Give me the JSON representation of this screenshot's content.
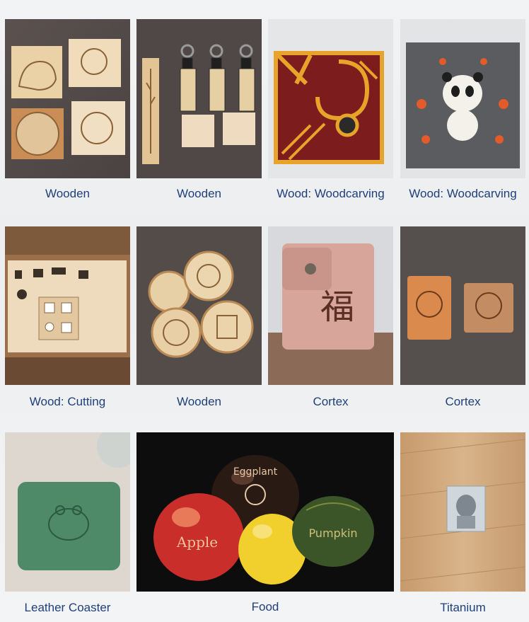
{
  "gallery": {
    "items": [
      {
        "label": "Wooden"
      },
      {
        "label": "Wooden"
      },
      {
        "label": "Wood: Woodcarving"
      },
      {
        "label": "Wood: Woodcarving"
      },
      {
        "label": "Wood: Cutting"
      },
      {
        "label": "Wooden"
      },
      {
        "label": "Cortex"
      },
      {
        "label": "Cortex"
      },
      {
        "label": "Leather Coaster"
      },
      {
        "label": "Food"
      },
      {
        "label": "Titanium"
      }
    ],
    "engraved_text": {
      "eggplant": "Eggplant",
      "apple": "Apple",
      "pumpkin": "Pumpkin",
      "wallet_char": "福"
    }
  },
  "colors": {
    "caption": "#1f3f7a",
    "wood_light": "#e8cfa6",
    "table_dark": "#5a524e"
  }
}
